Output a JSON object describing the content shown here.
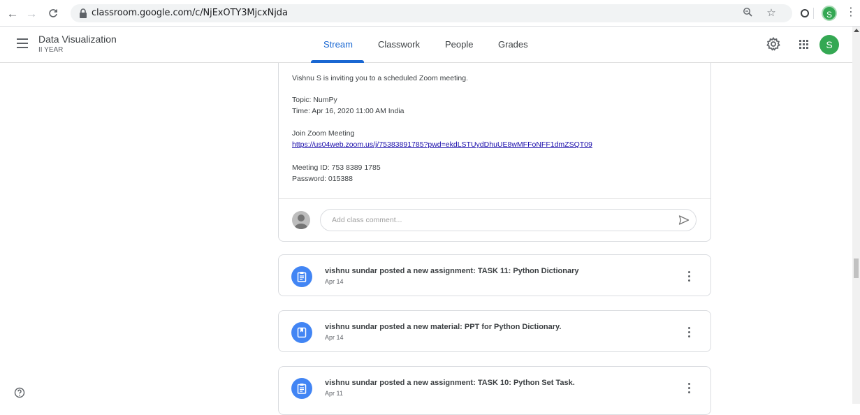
{
  "browser": {
    "url": "classroom.google.com/c/NjExOTY3MjcxNjda",
    "profile_initial": "S",
    "menu_glyph": "⋮"
  },
  "header": {
    "class_name": "Data Visualization",
    "class_section": "II YEAR",
    "tabs": [
      {
        "label": "Stream",
        "active": true
      },
      {
        "label": "Classwork",
        "active": false
      },
      {
        "label": "People",
        "active": false
      },
      {
        "label": "Grades",
        "active": false
      }
    ],
    "user_initial": "S"
  },
  "announcement": {
    "lines": [
      "Vishnu S is inviting you to a scheduled Zoom meeting.",
      "Topic: NumPy",
      "Time: Apr 16, 2020 11:00 AM India",
      "Join Zoom Meeting",
      "https://us04web.zoom.us/j/75383891785?pwd=ekdLSTUydDhuUE8wMFFoNFF1dmZSQT09",
      "Meeting ID: 753 8389 1785",
      "Password: 015388"
    ],
    "comment_placeholder": "Add class comment..."
  },
  "posts": [
    {
      "icon": "assignment-icon",
      "title": "vishnu sundar posted a new assignment: TASK 11: Python Dictionary",
      "date": "Apr 14"
    },
    {
      "icon": "material-icon",
      "title": "vishnu sundar posted a new material: PPT for Python Dictionary.",
      "date": "Apr 14"
    },
    {
      "icon": "assignment-icon",
      "title": "vishnu sundar posted a new assignment: TASK 10: Python Set Task.",
      "date": "Apr 11"
    }
  ],
  "colors": {
    "accent": "#1967d2",
    "post_icon": "#4285f4",
    "avatar": "#34a853",
    "link": "#1a0dab"
  }
}
